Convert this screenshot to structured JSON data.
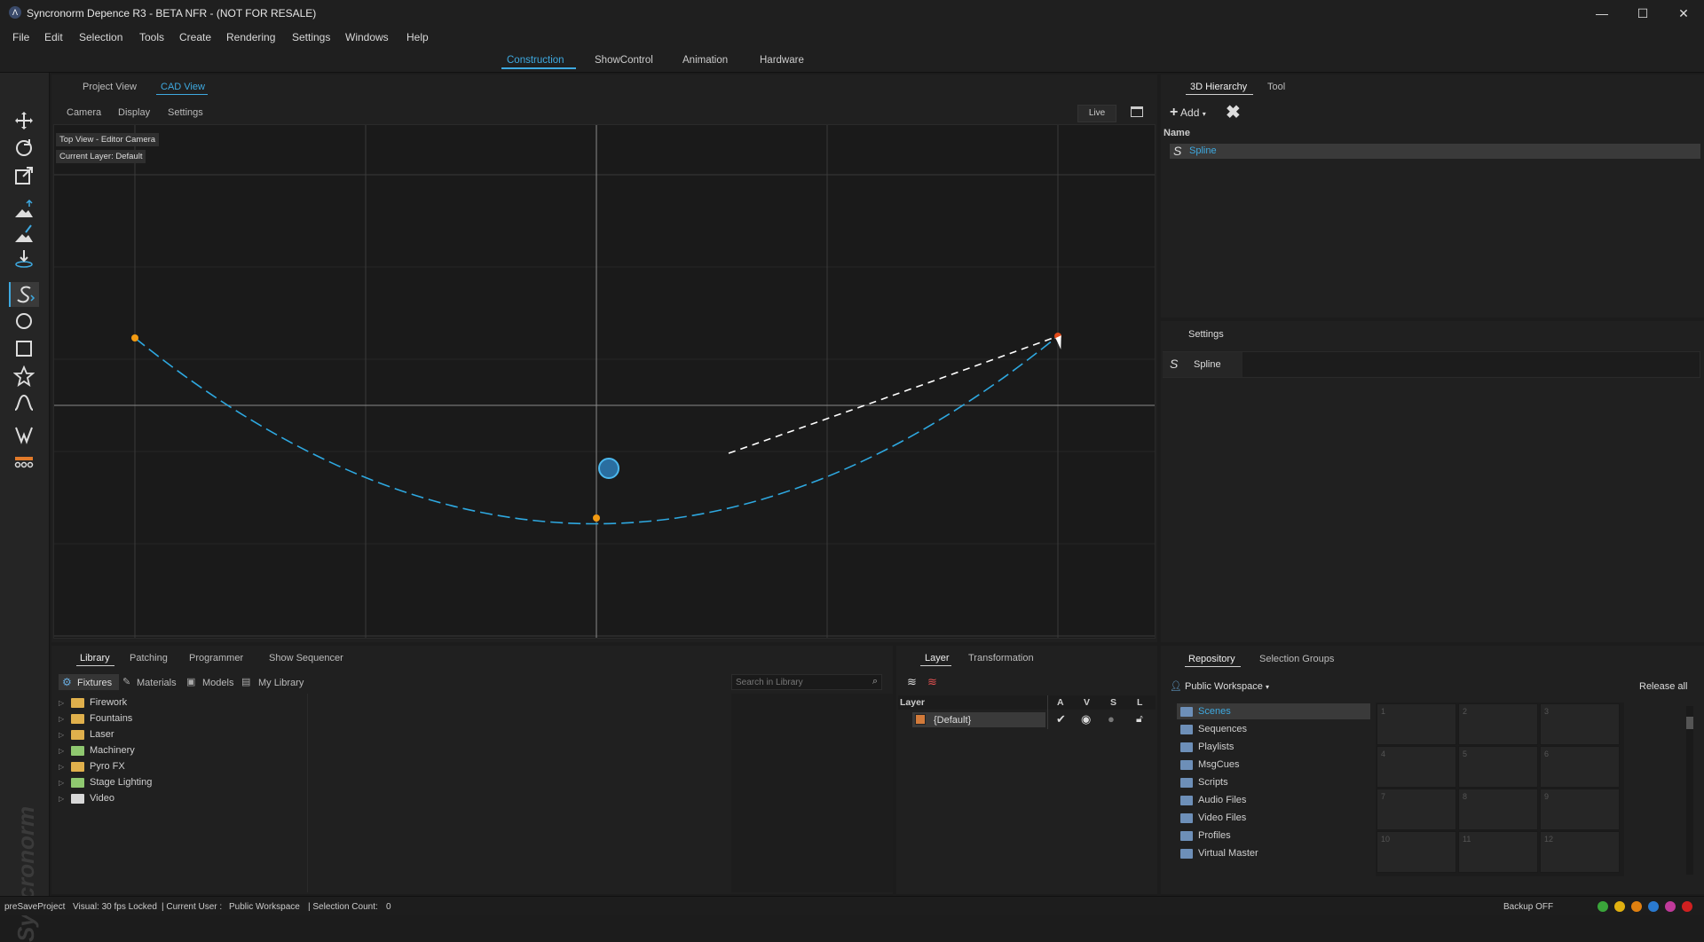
{
  "window": {
    "title": "Syncronorm Depence R3 - BETA NFR - (NOT FOR RESALE)",
    "minimize": "—",
    "maximize": "☐",
    "close": "✕"
  },
  "menu": [
    "File",
    "Edit",
    "Selection",
    "Tools",
    "Create",
    "Rendering",
    "Settings",
    "Windows",
    "Help"
  ],
  "modes": {
    "items": [
      "Construction",
      "ShowControl",
      "Animation",
      "Hardware"
    ],
    "active": "Construction"
  },
  "viewTabs": {
    "items": [
      "Project View",
      "CAD View"
    ],
    "active": "CAD View"
  },
  "viewMenu": [
    "Camera",
    "Display",
    "Settings"
  ],
  "viewport": {
    "live": "Live",
    "camera_label": "Top View - Editor Camera",
    "layer_label": "Current Layer: Default"
  },
  "hierarchy": {
    "tabs": [
      "3D Hierarchy",
      "Tool"
    ],
    "add": "Add",
    "column": "Name",
    "items": [
      "Spline"
    ]
  },
  "settings": {
    "title": "Settings",
    "item": "Spline"
  },
  "library": {
    "tabs": [
      "Library",
      "Patching",
      "Programmer",
      "Show Sequencer"
    ],
    "subtabs": [
      "Fixtures",
      "Materials",
      "Models",
      "My Library"
    ],
    "search_placeholder": "Search in Library",
    "folders": [
      "Firework",
      "Fountains",
      "Laser",
      "Machinery",
      "Pyro FX",
      "Stage Lighting",
      "Video"
    ]
  },
  "layer": {
    "tabs": [
      "Layer",
      "Transformation"
    ],
    "columns": [
      "Layer",
      "A",
      "V",
      "S",
      "L"
    ],
    "row": "{Default}",
    "row_color": "#d27a3a"
  },
  "repository": {
    "tabs": [
      "Repository",
      "Selection Groups"
    ],
    "workspace": "Public Workspace",
    "release": "Release all",
    "items": [
      "Scenes",
      "Sequences",
      "Playlists",
      "MsgCues",
      "Scripts",
      "Audio Files",
      "Video Files",
      "Profiles",
      "Virtual Master"
    ],
    "grid": [
      "1",
      "2",
      "3",
      "4",
      "5",
      "6",
      "7",
      "8",
      "9",
      "10",
      "11",
      "12"
    ]
  },
  "status": {
    "project": "preSaveProject",
    "visual": "Visual: 30 fps Locked",
    "user": "| Current User :",
    "workspace": "Public Workspace",
    "selection": "| Selection Count:",
    "count": "0",
    "backup": "Backup OFF"
  },
  "brand": "Syncronorm",
  "colors": {
    "accent": "#3ea9e0",
    "spline_point": "#f29a12",
    "spline_end": "#e04a1a"
  }
}
